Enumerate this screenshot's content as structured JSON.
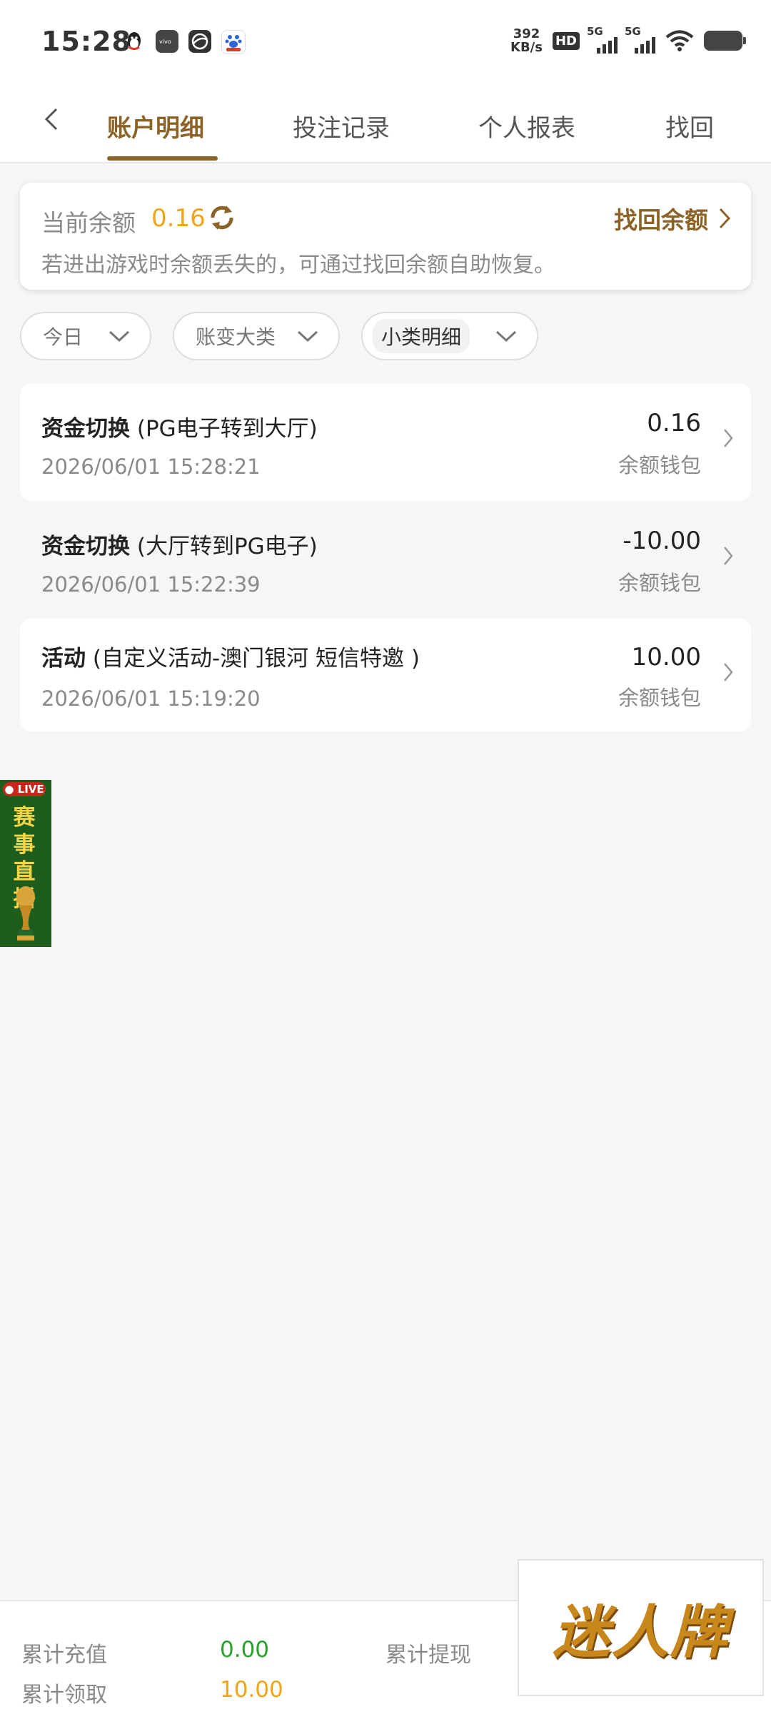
{
  "status_bar": {
    "time": "15:28",
    "net_speed_value": "392",
    "net_speed_unit": "KB/s",
    "hd_label": "HD",
    "sim1_label": "5G",
    "sim2_label": "5G"
  },
  "tabs": [
    {
      "label": "账户明细",
      "active": true
    },
    {
      "label": "投注记录",
      "active": false
    },
    {
      "label": "个人报表",
      "active": false
    },
    {
      "label": "找回",
      "active": false
    }
  ],
  "balance": {
    "label": "当前余额",
    "value": "0.16",
    "recover_label": "找回余额",
    "hint": "若进出游戏时余额丢失的，可通过找回余额自助恢复。"
  },
  "filters": [
    {
      "label": "今日"
    },
    {
      "label": "账变大类"
    },
    {
      "label": "小类明细"
    }
  ],
  "records": [
    {
      "type": "资金切换",
      "detail": "(PG电子转到大厅)",
      "time": "2026/06/01 15:28:21",
      "amount": "0.16",
      "wallet": "余额钱包"
    },
    {
      "type": "资金切换",
      "detail": "(大厅转到PG电子)",
      "time": "2026/06/01 15:22:39",
      "amount": "-10.00",
      "wallet": "余额钱包"
    },
    {
      "type": "活动",
      "detail": "(自定义活动-澳门银河 短信特邀 )",
      "time": "2026/06/01 15:19:20",
      "amount": "10.00",
      "wallet": "余额钱包"
    }
  ],
  "live_banner": {
    "tag": "LIVE",
    "text": "赛事直播"
  },
  "summary": {
    "recharge_label": "累计充值",
    "recharge_value": "0.00",
    "withdraw_label": "累计提现",
    "claim_label": "累计领取",
    "claim_value": "10.00",
    "colors": {
      "recharge": "#2ca02c",
      "claim": "#f0a417"
    }
  },
  "logo": {
    "text": "迷人牌"
  },
  "colors": {
    "accent": "#8b6326",
    "balance": "#f0a417",
    "background": "#f6f6f6"
  }
}
